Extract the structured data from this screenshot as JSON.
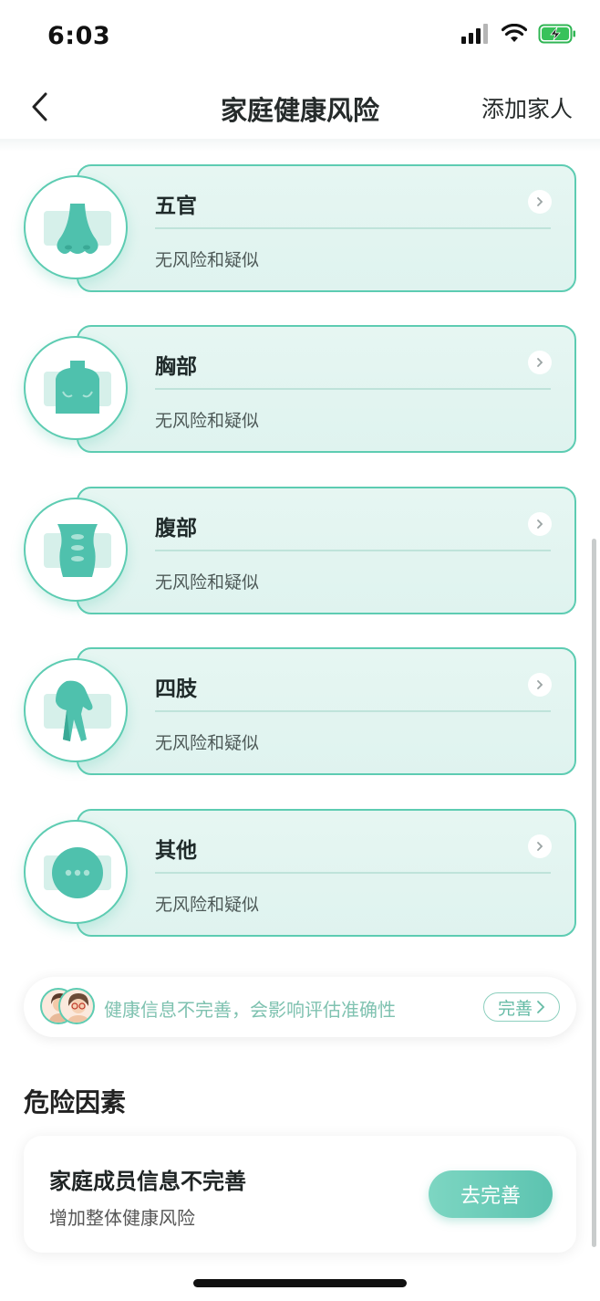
{
  "status_bar": {
    "time": "6:03"
  },
  "nav": {
    "title": "家庭健康风险",
    "action": "添加家人"
  },
  "risk_categories": [
    {
      "name": "五官",
      "status": "无风险和疑似",
      "icon": "nose-icon"
    },
    {
      "name": "胸部",
      "status": "无风险和疑似",
      "icon": "chest-icon"
    },
    {
      "name": "腹部",
      "status": "无风险和疑似",
      "icon": "abdomen-icon"
    },
    {
      "name": "四肢",
      "status": "无风险和疑似",
      "icon": "limbs-icon"
    },
    {
      "name": "其他",
      "status": "无风险和疑似",
      "icon": "more-icon"
    }
  ],
  "notice": {
    "text": "健康信息不完善，会影响评估准确性",
    "button": "完善"
  },
  "danger_section": {
    "title": "危险因素",
    "card": {
      "title": "家庭成员信息不完善",
      "subtitle": "增加整体健康风险",
      "button": "去完善"
    }
  },
  "colors": {
    "accent": "#5dccb2",
    "card_bg": "#e2f5f1",
    "icon_fill": "#4fc1ad"
  }
}
